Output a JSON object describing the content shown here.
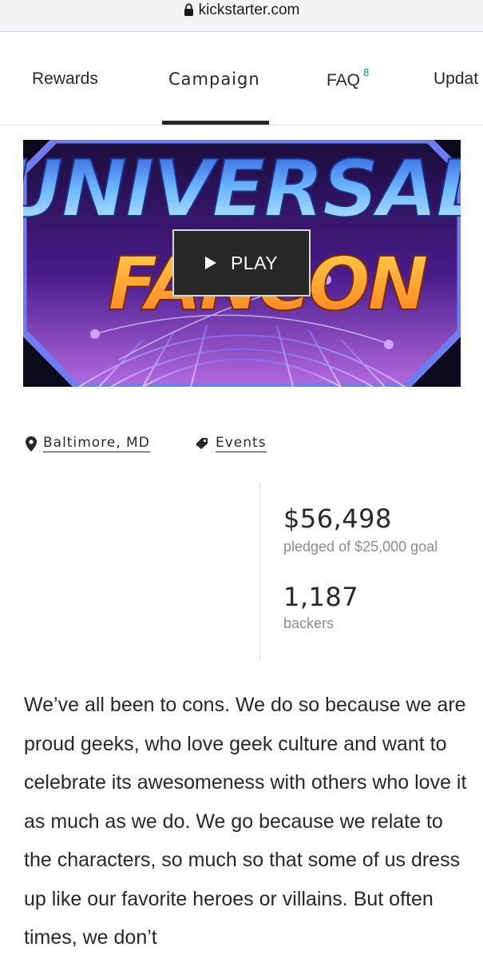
{
  "browser": {
    "url": "kickstarter.com",
    "icon": "lock-icon"
  },
  "tabs": [
    {
      "label": "Rewards"
    },
    {
      "label": "Campaign",
      "active": true
    },
    {
      "label": "FAQ",
      "badge": "8"
    },
    {
      "label": "Updat"
    }
  ],
  "hero": {
    "title_line1": "UNIVERSAL",
    "title_line2": "FANCON",
    "play_label": "PLAY"
  },
  "meta": {
    "location": "Baltimore, MD",
    "category": "Events",
    "location_icon": "map-pin-icon",
    "category_icon": "tag-icon"
  },
  "stats": {
    "pledged": "$56,498",
    "pledged_label": "pledged of $25,000 goal",
    "backers": "1,187",
    "backers_label": "backers"
  },
  "description": "We’ve all been to cons. We do so because we are proud geeks, who love geek culture and want to celebrate its awesomeness with others who love it as much as we do. We go because we relate to the characters, so much so that some of us dress up like our favorite heroes or villains. But often times, we don’t",
  "colors": {
    "tab_badge": "#009e74",
    "hero_border": "#6f7cf0",
    "title_blue": "#8fd6ff",
    "title_orange": "#ffae2e"
  }
}
